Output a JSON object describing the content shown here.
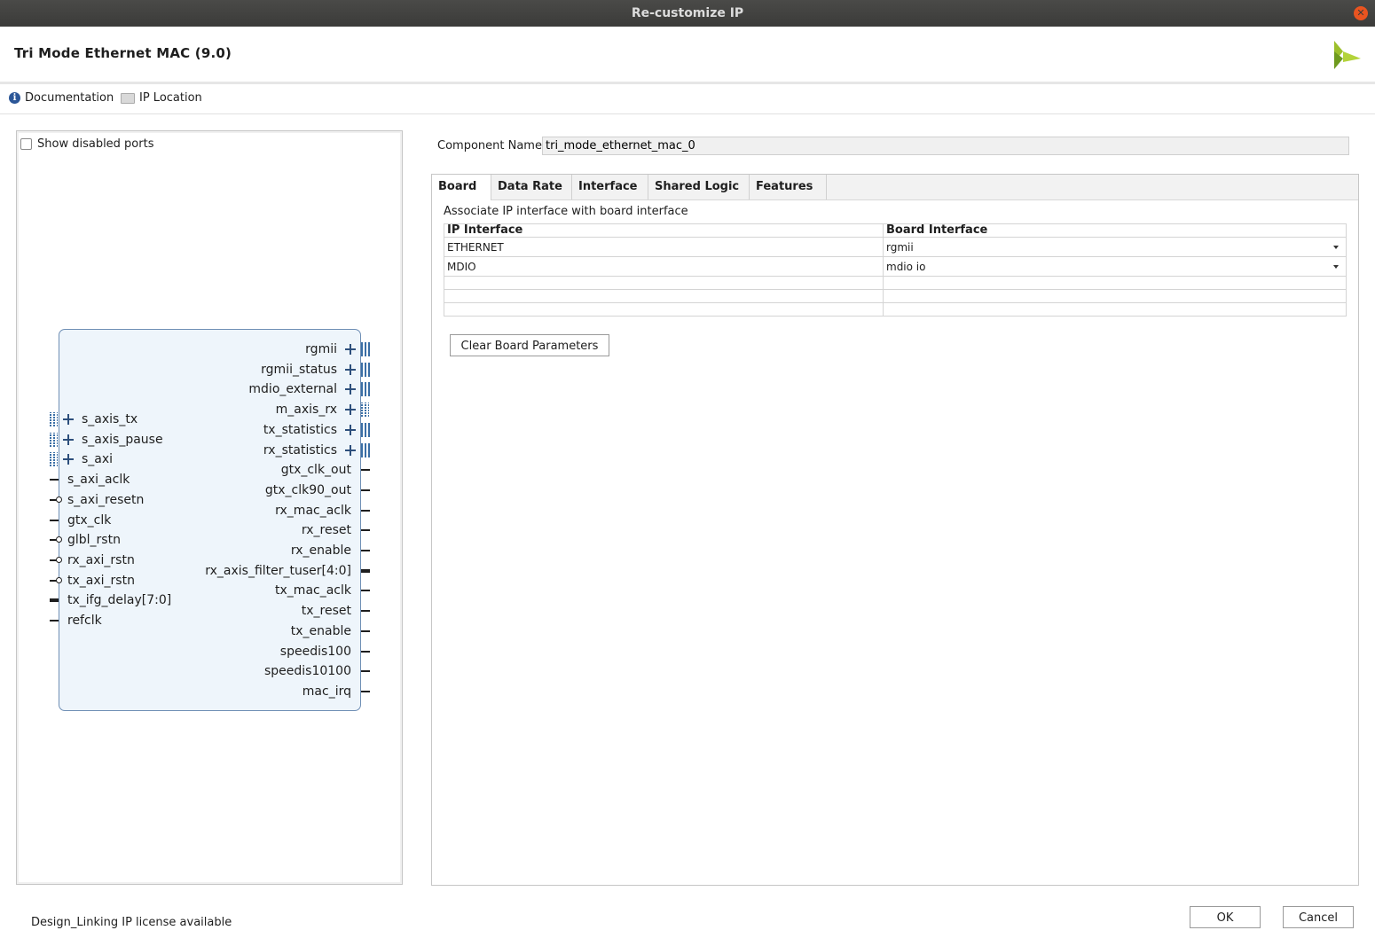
{
  "window": {
    "title": "Re-customize IP"
  },
  "header": {
    "title": "Tri Mode Ethernet MAC (9.0)"
  },
  "links": {
    "documentation": "Documentation",
    "ip_location": "IP Location"
  },
  "left": {
    "show_disabled_ports": "Show disabled ports",
    "left_ports": [
      "s_axis_tx",
      "s_axis_pause",
      "s_axi",
      "s_axi_aclk",
      "s_axi_resetn",
      "gtx_clk",
      "glbl_rstn",
      "rx_axi_rstn",
      "tx_axi_rstn",
      "tx_ifg_delay[7:0]",
      "refclk"
    ],
    "right_ports": [
      "rgmii",
      "rgmii_status",
      "mdio_external",
      "m_axis_rx",
      "tx_statistics",
      "rx_statistics",
      "gtx_clk_out",
      "gtx_clk90_out",
      "rx_mac_aclk",
      "rx_reset",
      "rx_enable",
      "rx_axis_filter_tuser[4:0]",
      "tx_mac_aclk",
      "tx_reset",
      "tx_enable",
      "speedis100",
      "speedis10100",
      "mac_irq"
    ]
  },
  "component": {
    "label": "Component Name",
    "value": "tri_mode_ethernet_mac_0"
  },
  "tabs": [
    "Board",
    "Data Rate",
    "Interface",
    "Shared Logic",
    "Features"
  ],
  "board": {
    "assoc_text": "Associate IP interface with board interface",
    "col_ip": "IP Interface",
    "col_board": "Board Interface",
    "rows": [
      {
        "ip": "ETHERNET",
        "board": "rgmii"
      },
      {
        "ip": "MDIO",
        "board": "mdio io"
      }
    ],
    "clear_button": "Clear Board Parameters"
  },
  "footer": {
    "license": "Design_Linking IP license available",
    "ok": "OK",
    "cancel": "Cancel"
  },
  "colors": {
    "accent": "#e95420",
    "block_fill": "#eef5fb",
    "block_border": "#6f8fb5",
    "bus": "#3a6ea5"
  }
}
